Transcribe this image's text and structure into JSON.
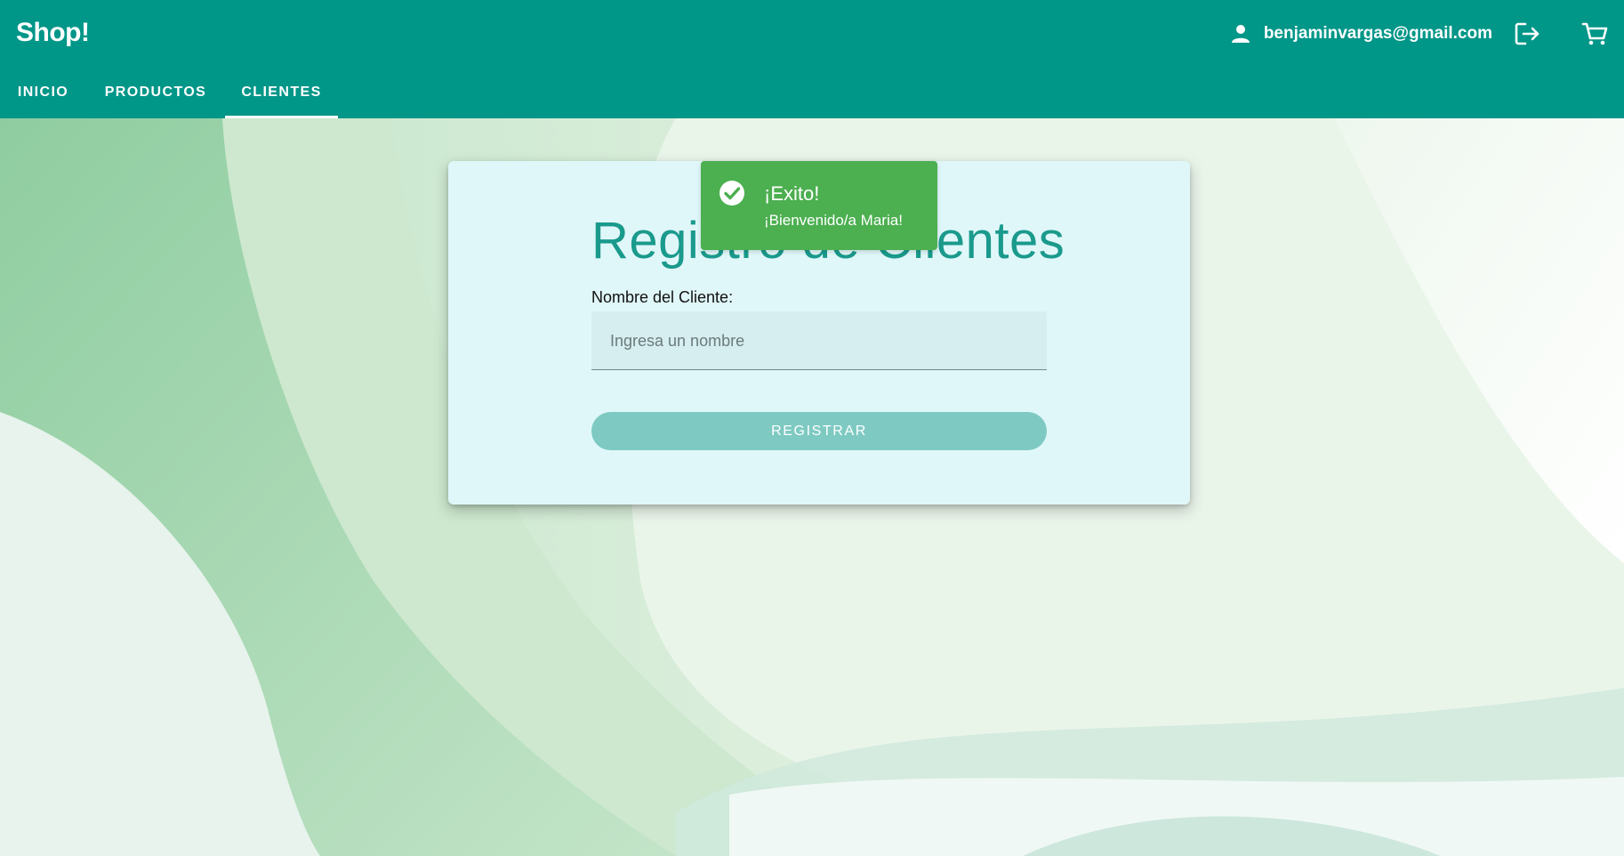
{
  "header": {
    "brand": "Shop!",
    "user_email": "benjaminvargas@gmail.com",
    "user_icon": "person-icon",
    "logout_icon": "logout-icon",
    "cart_icon": "cart-icon",
    "color": "#009688"
  },
  "nav": {
    "tabs": [
      {
        "label": "INICIO",
        "active": false
      },
      {
        "label": "PRODUCTOS",
        "active": false
      },
      {
        "label": "CLIENTES",
        "active": true
      }
    ]
  },
  "form": {
    "title": "Registro de Clientes",
    "name_label": "Nombre del Cliente:",
    "name_value": "",
    "name_placeholder": "Ingresa un nombre",
    "submit_label": "REGISTRAR",
    "title_color": "#1a9a8c",
    "button_color": "#7ecac3"
  },
  "toast": {
    "title": "¡Exito!",
    "message": "¡Bienvenido/a Maria!",
    "icon": "check-circle-icon",
    "color": "#4caf50"
  }
}
